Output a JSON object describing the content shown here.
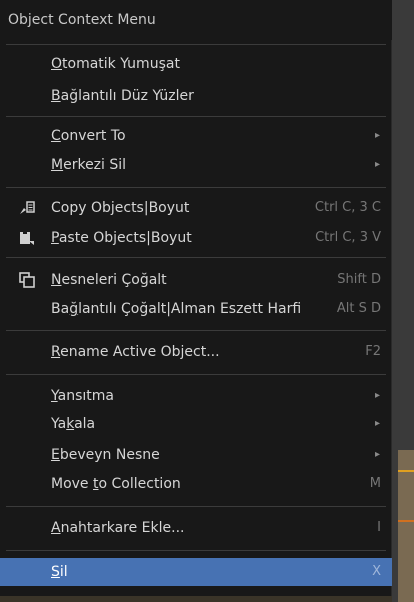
{
  "menu": {
    "title": "Object Context Menu",
    "items": [
      {
        "label": "Otomatik Yumuşat",
        "u": "O",
        "rest": "tomatik Yumuşat",
        "shortcut": "",
        "submenu": false
      },
      {
        "label": "Bağlantılı Düz Yüzler",
        "u": "B",
        "rest": "ağlantılı Düz Yüzler",
        "shortcut": "",
        "submenu": false
      },
      {
        "label": "Convert To",
        "u": "C",
        "rest": "onvert To",
        "shortcut": "",
        "submenu": true
      },
      {
        "label": "Merkezi Sil",
        "u": "M",
        "rest": "erkezi Sil",
        "shortcut": "",
        "submenu": true
      },
      {
        "label": "Copy Objects|Boyut",
        "shortcut": "Ctrl C, 3 C",
        "icon": "copy-icon"
      },
      {
        "label": "Paste Objects|Boyut",
        "u": "P",
        "rest": "aste Objects|Boyut",
        "shortcut": "Ctrl C, 3 V",
        "icon": "paste-icon"
      },
      {
        "label": "Nesneleri Çoğalt",
        "u": "N",
        "rest": "esneleri Çoğalt",
        "shortcut": "Shift D",
        "icon": "duplicate-icon"
      },
      {
        "label": "Bağlantılı Çoğalt|Alman Eszett Harfi",
        "pre": "Ba",
        "u": "ğ",
        "rest": "lantılı Çoğalt|Alman Eszett Harfi",
        "shortcut": "Alt S D"
      },
      {
        "label": "Rename Active Object...",
        "u": "R",
        "rest": "ename Active Object...",
        "shortcut": "F2"
      },
      {
        "label": "Yansıtma",
        "u": "Y",
        "rest": "ansıtma",
        "submenu": true
      },
      {
        "label": "Yakala",
        "pre": "Ya",
        "u": "k",
        "rest": "ala",
        "submenu": true
      },
      {
        "label": "Ebeveyn Nesne",
        "u": "E",
        "rest": "beveyn Nesne",
        "submenu": true
      },
      {
        "label": "Move to Collection",
        "pre": "Move ",
        "u": "t",
        "rest": "o Collection",
        "shortcut": "M"
      },
      {
        "label": "Anahtarkare Ekle...",
        "u": "A",
        "rest": "nahtarkare Ekle...",
        "shortcut": "I"
      },
      {
        "label": "Sil",
        "u": "S",
        "rest": "il",
        "shortcut": "X",
        "active": true
      }
    ],
    "submenu_arrow": "▸"
  }
}
